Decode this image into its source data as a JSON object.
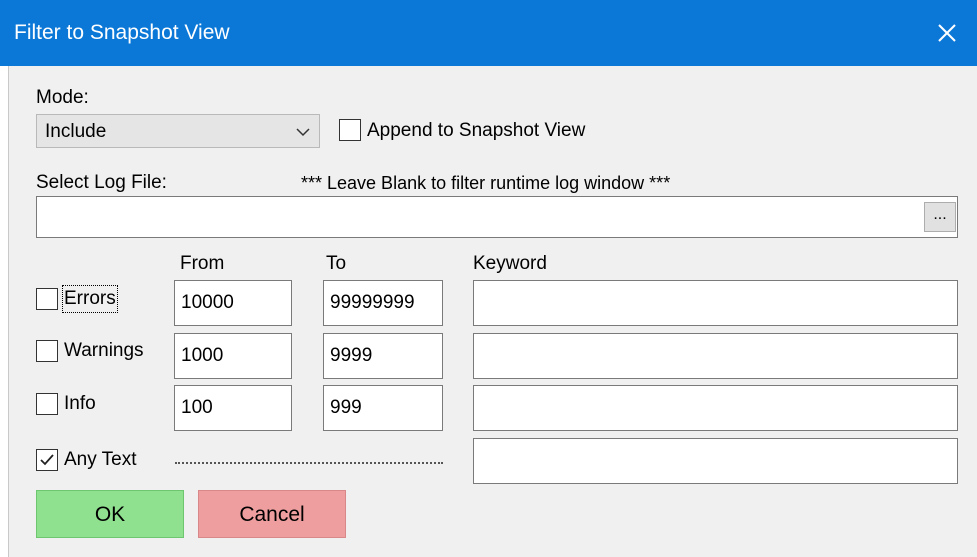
{
  "window": {
    "title": "Filter to Snapshot View",
    "close_icon": "close-icon",
    "title_bar_color": "#0b78d8"
  },
  "mode": {
    "label": "Mode:",
    "selected": "Include",
    "append_label": "Append to Snapshot View",
    "append_checked": false
  },
  "log_file": {
    "label": "Select Log File:",
    "hint": "*** Leave Blank to filter runtime log window ***",
    "value": "",
    "browse_label": "..."
  },
  "columns": {
    "from": "From",
    "to": "To",
    "keyword": "Keyword"
  },
  "rows": [
    {
      "label": "Errors",
      "checked": false,
      "from": "10000",
      "to": "99999999",
      "keyword": ""
    },
    {
      "label": "Warnings",
      "checked": false,
      "from": "1000",
      "to": "9999",
      "keyword": ""
    },
    {
      "label": "Info",
      "checked": false,
      "from": "100",
      "to": "999",
      "keyword": ""
    }
  ],
  "any_text": {
    "label": "Any Text",
    "checked": true,
    "keyword": ""
  },
  "buttons": {
    "ok": "OK",
    "cancel": "Cancel",
    "ok_color": "#8fe08f",
    "cancel_color": "#ee9e9e"
  }
}
